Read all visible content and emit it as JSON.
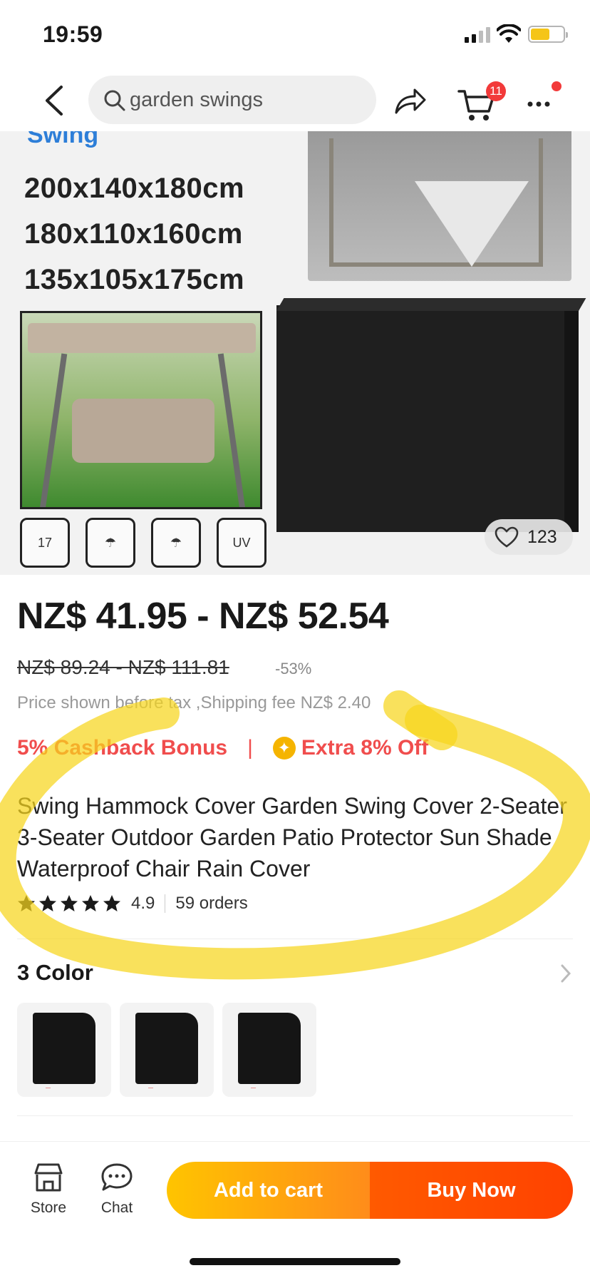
{
  "status": {
    "time": "19:59"
  },
  "nav": {
    "search_placeholder": "garden swings",
    "cart_count": "11"
  },
  "hero": {
    "swing_label": "Swing",
    "dims": [
      "200x140x180cm",
      "180x110x160cm",
      "135x105x175cm"
    ],
    "feature_icons": [
      "17",
      "",
      "",
      "UV"
    ],
    "likes": "123"
  },
  "price": {
    "current": "NZ$ 41.95 - NZ$ 52.54",
    "original": "NZ$ 89.24 - NZ$ 111.81",
    "discount": "-53%",
    "tax_note": "Price shown before tax ,Shipping fee NZ$ 2.40"
  },
  "promos": {
    "cashback": "5% Cashback Bonus",
    "separator": "|",
    "extra": "Extra 8% Off"
  },
  "product": {
    "title": "Swing Hammock Cover Garden Swing Cover 2-Seater 3-Seater Outdoor Garden Patio Protector Sun Shade Waterproof Chair Rain Cover",
    "rating": "4.9",
    "orders": "59 orders",
    "star_count": 5
  },
  "color_section": {
    "title": "3 Color",
    "swatch_count": 3
  },
  "bottom_bar": {
    "store_label": "Store",
    "chat_label": "Chat",
    "add_to_cart": "Add to cart",
    "buy_now": "Buy Now"
  },
  "colors": {
    "accent_red": "#f04d4d",
    "cta_orange_start": "#ffc400",
    "cta_red": "#ff4200",
    "annotation_yellow": "#f7d51d"
  }
}
